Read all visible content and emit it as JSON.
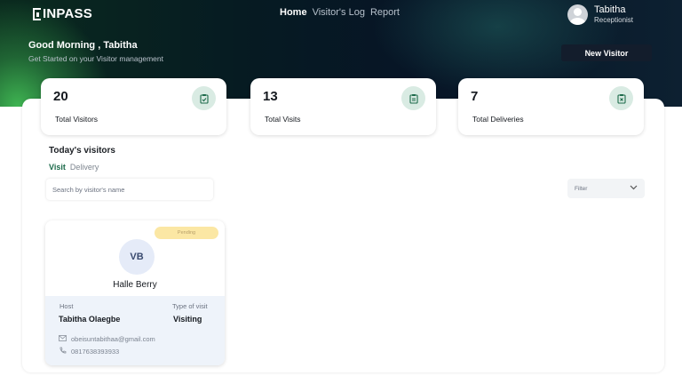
{
  "brand": {
    "name": "INPASS"
  },
  "nav": {
    "items": [
      {
        "label": "Home",
        "active": true
      },
      {
        "label": "Visitor's Log",
        "active": false
      },
      {
        "label": "Report",
        "active": false
      }
    ]
  },
  "user": {
    "name": "Tabitha",
    "role": "Receptionist",
    "icon": "avatar-icon"
  },
  "hero": {
    "greeting": "Good Morning , Tabitha",
    "subtitle": "Get Started on your Visitor management",
    "new_visitor_label": "New Visitor"
  },
  "stats": [
    {
      "value": "20",
      "label": "Total Visitors",
      "icon": "clipboard-check-icon"
    },
    {
      "value": "13",
      "label": "Total Visits",
      "icon": "clipboard-list-icon"
    },
    {
      "value": "7",
      "label": "Total Deliveries",
      "icon": "clipboard-x-icon"
    }
  ],
  "todays": {
    "title": "Today's visitors",
    "tabs": [
      {
        "label": "Visit",
        "active": true
      },
      {
        "label": "Delivery",
        "active": false
      }
    ],
    "search_placeholder": "Search by visitor's name",
    "filter_label": "Filter"
  },
  "visitor_card": {
    "status": "Pending",
    "initials": "VB",
    "name": "Halle Berry",
    "host_label": "Host",
    "host": "Tabitha Olaegbe",
    "visit_type_label": "Type of visit",
    "visit_type": "Visiting",
    "email": "obeisuntabithaa@gmail.com",
    "phone": "0817638393933"
  },
  "colors": {
    "accent_green": "#1c6a4a",
    "icon_bg": "#d9ebe3",
    "button_dark": "#131d2c",
    "badge_yellow": "#fbe7a4"
  }
}
